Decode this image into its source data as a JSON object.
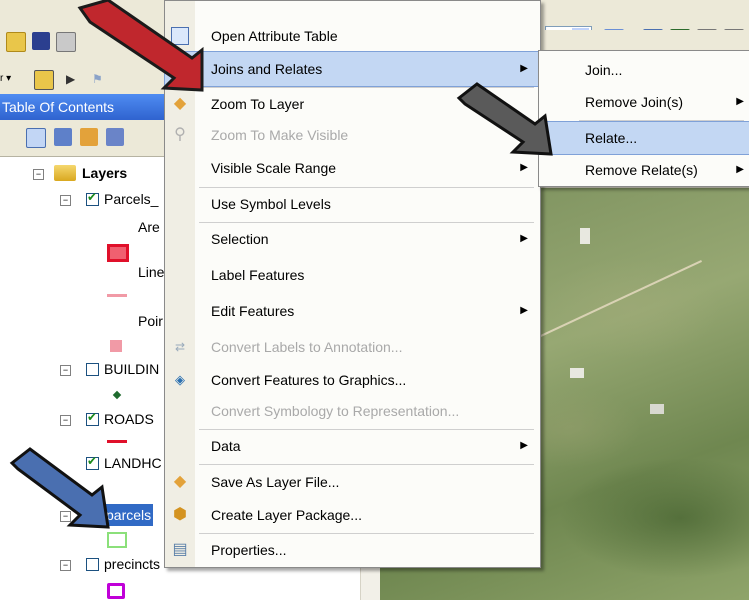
{
  "toc": {
    "title": "Table Of Contents",
    "root_label": "Layers",
    "layers": [
      {
        "label": "Parcels_",
        "checked": true,
        "legend": [
          {
            "label": "Are",
            "color": "#e0102a"
          },
          {
            "label": "Line",
            "color": "#f19aa6"
          },
          {
            "label": "Poir",
            "color": "#f19aa6"
          }
        ]
      },
      {
        "label": "BUILDIN",
        "checked": false,
        "color": "#1f6b2e"
      },
      {
        "label": "ROADS",
        "checked": true,
        "color": "#e0102a"
      },
      {
        "label": "LANDHC",
        "checked": true
      },
      {
        "label": "parcels",
        "checked": true,
        "selected": true,
        "color": "#8be07a"
      },
      {
        "label": "precincts",
        "checked": false,
        "color": "#c000d8"
      }
    ]
  },
  "context_menu": {
    "items": [
      {
        "label": "Open Attribute Table",
        "icon": "table-icon",
        "enabled": true
      },
      {
        "label": "Joins and Relates",
        "icon": "",
        "enabled": true,
        "submenu": true,
        "highlighted": true
      },
      {
        "label": "Zoom To Layer",
        "icon": "zoom-icon",
        "enabled": true
      },
      {
        "label": "Zoom To Make Visible",
        "icon": "zoom-visible-icon",
        "enabled": false
      },
      {
        "label": "Visible Scale Range",
        "icon": "",
        "enabled": true,
        "submenu": true
      },
      {
        "label": "Use Symbol Levels",
        "icon": "",
        "enabled": true
      },
      {
        "label": "Selection",
        "icon": "",
        "enabled": true,
        "submenu": true
      },
      {
        "label": "Label Features",
        "icon": "",
        "enabled": true
      },
      {
        "label": "Edit Features",
        "icon": "",
        "enabled": true,
        "submenu": true
      },
      {
        "label": "Convert Labels to Annotation...",
        "icon": "convert-labels-icon",
        "enabled": false
      },
      {
        "label": "Convert Features to Graphics...",
        "icon": "convert-graphics-icon",
        "enabled": true
      },
      {
        "label": "Convert Symbology to Representation...",
        "icon": "",
        "enabled": false
      },
      {
        "label": "Data",
        "icon": "",
        "enabled": true,
        "submenu": true
      },
      {
        "label": "Save As Layer File...",
        "icon": "layer-file-icon",
        "enabled": true
      },
      {
        "label": "Create Layer Package...",
        "icon": "layer-package-icon",
        "enabled": true
      },
      {
        "label": "Properties...",
        "icon": "properties-icon",
        "enabled": true
      }
    ]
  },
  "submenu": {
    "items": [
      {
        "label": "Join...",
        "submenu": false
      },
      {
        "label": "Remove Join(s)",
        "submenu": true
      },
      {
        "label": "Relate...",
        "submenu": false,
        "highlighted": true
      },
      {
        "label": "Remove Relate(s)",
        "submenu": true
      }
    ]
  },
  "colors": {
    "highlight": "#c3d7f3",
    "toc_title": "#3e7be8",
    "pointer_red": "#c0272d",
    "pointer_blue": "#4a6fb0"
  }
}
